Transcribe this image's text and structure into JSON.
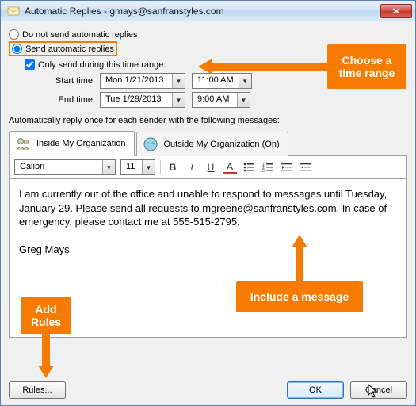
{
  "titlebar": {
    "title": "Automatic Replies - gmays@sanfranstyles.com"
  },
  "radios": {
    "no_send": "Do not send automatic replies",
    "send": "Send automatic replies"
  },
  "time": {
    "only_send": "Only send during this time range:",
    "start_label": "Start time:",
    "start_date": "Mon 1/21/2013",
    "start_time": "11:00 AM",
    "end_label": "End time:",
    "end_date": "Tue 1/29/2013",
    "end_time": "9:00 AM"
  },
  "section_label": "Automatically reply once for each sender with the following messages:",
  "tabs": {
    "inside": "Inside My Organization",
    "outside": "Outside My Organization (On)"
  },
  "toolbar": {
    "font": "Calibri",
    "size": "11",
    "bold": "B",
    "italic": "I",
    "underline": "U",
    "color": "A"
  },
  "editor": {
    "body": "I am currently out of the office and unable to respond to messages until Tuesday, January 29. Please send all requests to mgreene@sanfranstyles.com. In case of emergency, please contact me at 555-515-2795.\n\nGreg Mays"
  },
  "buttons": {
    "rules": "Rules...",
    "ok": "OK",
    "cancel": "Cancel"
  },
  "callouts": {
    "range": "Choose a\ntime range",
    "message": "Include a message",
    "rules": "Add\nRules"
  }
}
